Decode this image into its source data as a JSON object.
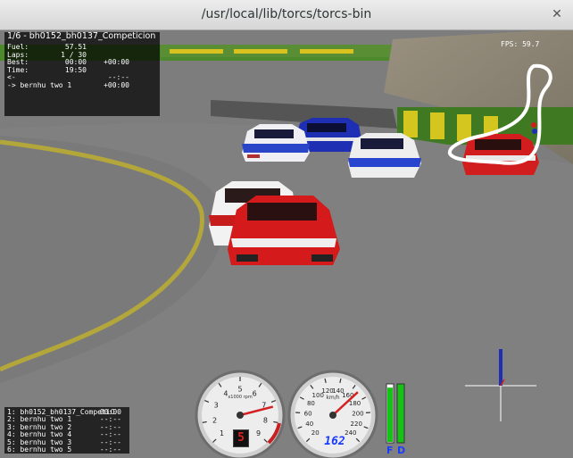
{
  "window": {
    "title": "/usr/local/lib/torcs/torcs-bin",
    "close_glyph": "✕"
  },
  "board": {
    "header": "1/6 - bh0152_bh0137_Competicion",
    "rows": [
      {
        "label": "Fuel:",
        "v1": "57.51",
        "v2": ""
      },
      {
        "label": "Laps:",
        "v1": "1 / 30",
        "v2": ""
      },
      {
        "label": "Best:",
        "v1": "00:00",
        "v2": "+00:00"
      },
      {
        "label": "Time:",
        "v1": "19:50",
        "v2": ""
      },
      {
        "label": "<-",
        "v1": "",
        "v2": "--:--"
      },
      {
        "label": "-> bernhu two 1",
        "v1": "",
        "v2": "+00:00"
      }
    ]
  },
  "fps": "FPS: 59.7",
  "standings": [
    {
      "text": "1: bh0152_bh0137_CompetiC",
      "gap": "00:00"
    },
    {
      "text": "2: bernhu two 1",
      "gap": "--:--"
    },
    {
      "text": "3: bernhu two 2",
      "gap": "--:--"
    },
    {
      "text": "4: bernhu two 4",
      "gap": "--:--"
    },
    {
      "text": "5: bernhu two 3",
      "gap": "--:--"
    },
    {
      "text": "6: bernhu two 5",
      "gap": "--:--"
    }
  ],
  "dash": {
    "gear": "5",
    "speed": "162",
    "rpm_unit": "x1000 rpm",
    "speed_unit": "km/h",
    "rpm_ticks": [
      "1",
      "2",
      "3",
      "4",
      "5",
      "6",
      "7",
      "8",
      "9"
    ],
    "speed_ticks": [
      "20",
      "40",
      "60",
      "80",
      "100",
      "120",
      "140",
      "160",
      "180",
      "200",
      "220",
      "240"
    ],
    "rpm_level": 0.78,
    "speed_level": 0.675,
    "fuel_label": "F",
    "damage_label": "D",
    "fuel_level": 0.95,
    "damage_level": 0.0
  },
  "colors": {
    "track_line": "#d8c41e",
    "car_red": "#d11d1d",
    "car_blue": "#1e2fb3",
    "gauge_needle": "#d42020",
    "dash_blue": "#1a3cff",
    "fuel_bar": "#17c217"
  }
}
